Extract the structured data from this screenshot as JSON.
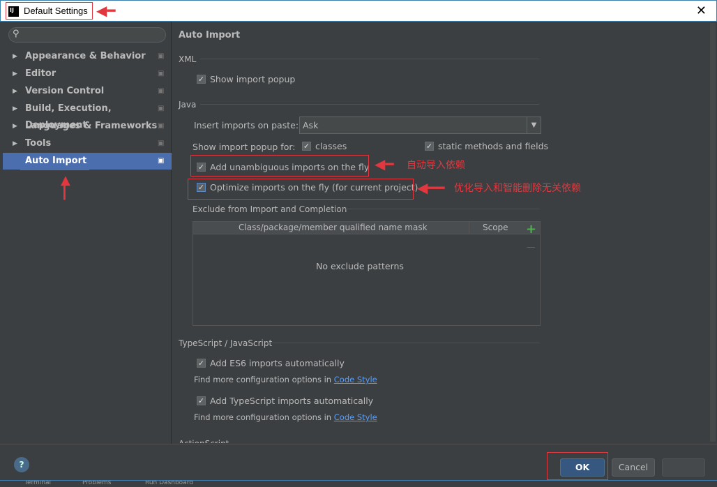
{
  "window": {
    "title": "Default Settings",
    "close": "✕",
    "logo": "IJ"
  },
  "sidebar": {
    "search_placeholder": "",
    "items": [
      {
        "label": "Appearance & Behavior"
      },
      {
        "label": "Editor"
      },
      {
        "label": "Version Control"
      },
      {
        "label": "Build, Execution, Deployment"
      },
      {
        "label": "Languages & Frameworks"
      },
      {
        "label": "Tools"
      },
      {
        "label": "Auto Import",
        "selected": true
      }
    ]
  },
  "main": {
    "title": "Auto Import",
    "xml": {
      "label": "XML",
      "show_popup": "Show import popup"
    },
    "java": {
      "label": "Java",
      "insert_label": "Insert imports on paste:",
      "insert_value": "Ask",
      "popup_for": "Show import popup for:",
      "classes": "classes",
      "static": "static methods and fields",
      "unambiguous": "Add unambiguous imports on the fly",
      "optimize": "Optimize imports on the fly (for current project)"
    },
    "exclude": {
      "label": "Exclude from Import and Completion",
      "col1": "Class/package/member qualified name mask",
      "col2": "Scope",
      "empty": "No exclude patterns",
      "add": "+",
      "remove": "—"
    },
    "ts": {
      "label": "TypeScript / JavaScript",
      "es6": "Add ES6 imports automatically",
      "find1": "Find more configuration options in",
      "link1": "Code Style",
      "tsimp": "Add TypeScript imports automatically",
      "find2": "Find more configuration options in",
      "link2": "Code Style"
    },
    "actionscript": "ActionScript"
  },
  "annotations": {
    "auto": "自动导入依赖",
    "optimize": "优化导入和智能删除无关依赖"
  },
  "footer": {
    "help": "?",
    "ok": "OK",
    "cancel": "Cancel",
    "apply": ""
  },
  "statusbar": {
    "items": [
      "Terminal",
      "Problems",
      "Run Dashboard"
    ]
  }
}
